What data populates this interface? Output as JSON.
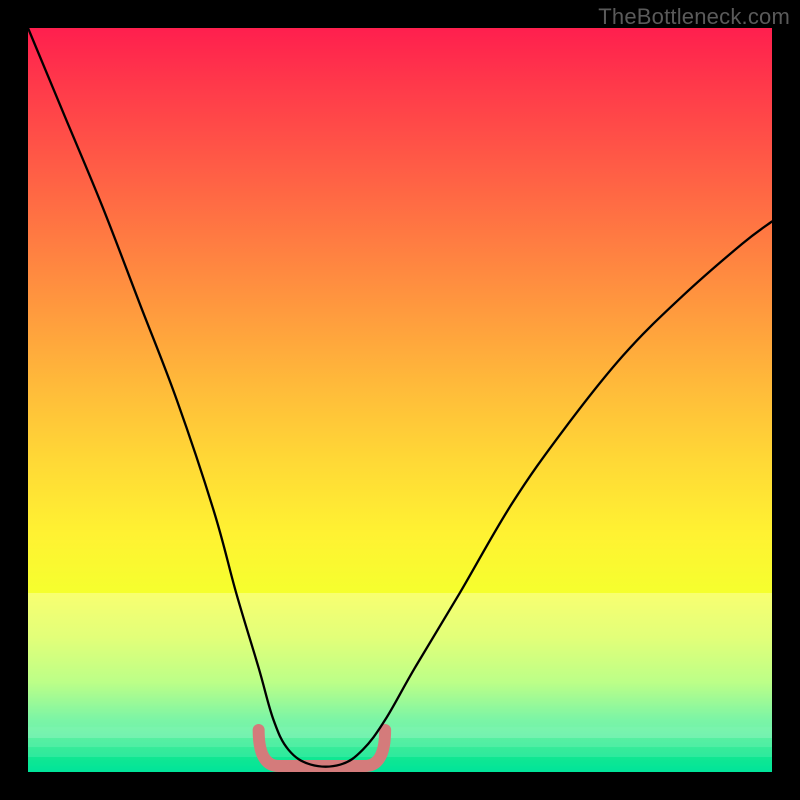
{
  "watermark": "TheBottleneck.com",
  "chart_data": {
    "type": "line",
    "title": "",
    "xlabel": "",
    "ylabel": "",
    "xlim": [
      0,
      100
    ],
    "ylim": [
      0,
      100
    ],
    "grid": false,
    "series": [
      {
        "name": "curve",
        "x": [
          0,
          5,
          10,
          15,
          20,
          25,
          28,
          31,
          33,
          35,
          38,
          42,
          45,
          48,
          52,
          58,
          65,
          72,
          80,
          88,
          96,
          100
        ],
        "values": [
          100,
          88,
          76,
          63,
          50,
          35,
          24,
          14,
          7,
          3,
          1,
          1,
          3,
          7,
          14,
          24,
          36,
          46,
          56,
          64,
          71,
          74
        ]
      }
    ],
    "valley_highlight": {
      "x_start": 31,
      "x_end": 48,
      "color": "#d47b7b",
      "stroke_width": 12
    }
  }
}
